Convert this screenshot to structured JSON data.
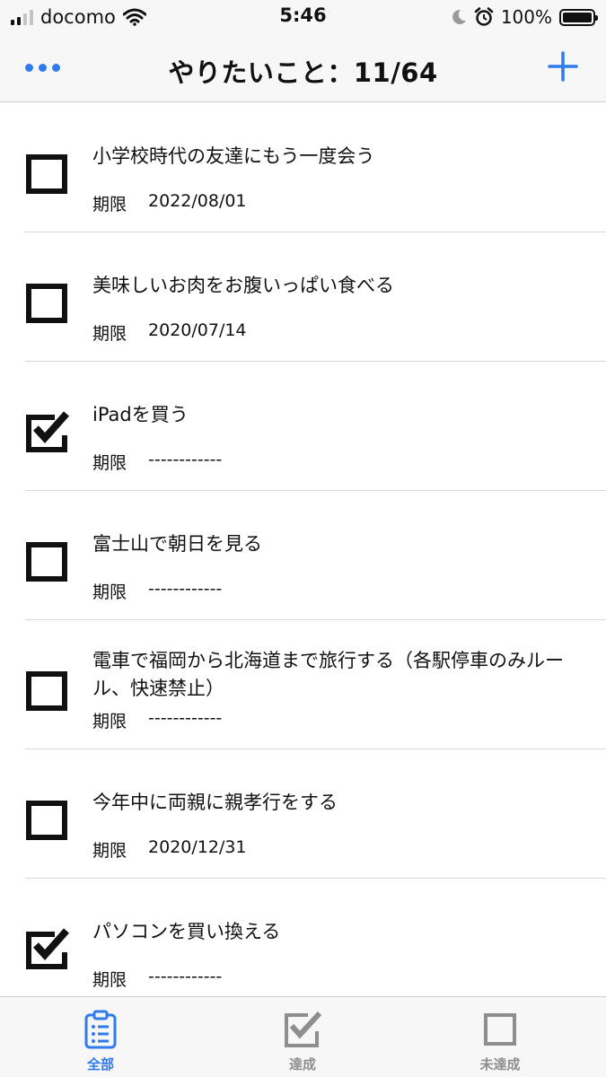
{
  "status_bar": {
    "carrier": "docomo",
    "time": "5:46",
    "battery": "100%"
  },
  "nav": {
    "title": "やりたいこと：11/64"
  },
  "items": [
    {
      "title": "小学校時代の友達にもう一度会う",
      "due_label": "期限",
      "due": "2022/08/01",
      "done": false
    },
    {
      "title": "美味しいお肉をお腹いっぱい食べる",
      "due_label": "期限",
      "due": "2020/07/14",
      "done": false
    },
    {
      "title": "iPadを買う",
      "due_label": "期限",
      "due": "------------",
      "done": true
    },
    {
      "title": "富士山で朝日を見る",
      "due_label": "期限",
      "due": "------------",
      "done": false
    },
    {
      "title": "電車で福岡から北海道まで旅行する（各駅停車のみルール、快速禁止）",
      "due_label": "期限",
      "due": "------------",
      "done": false
    },
    {
      "title": "今年中に両親に親孝行をする",
      "due_label": "期限",
      "due": "2020/12/31",
      "done": false
    },
    {
      "title": "パソコンを買い換える",
      "due_label": "期限",
      "due": "------------",
      "done": true
    }
  ],
  "tabs": [
    {
      "label": "全部",
      "icon": "clipboard-list-icon",
      "active": true
    },
    {
      "label": "達成",
      "icon": "checked-box-icon",
      "active": false
    },
    {
      "label": "未達成",
      "icon": "empty-box-icon",
      "active": false
    }
  ],
  "colors": {
    "accent": "#2f7bec",
    "inactive": "#8e8e8e",
    "bar_bg": "#f7f7f7"
  }
}
